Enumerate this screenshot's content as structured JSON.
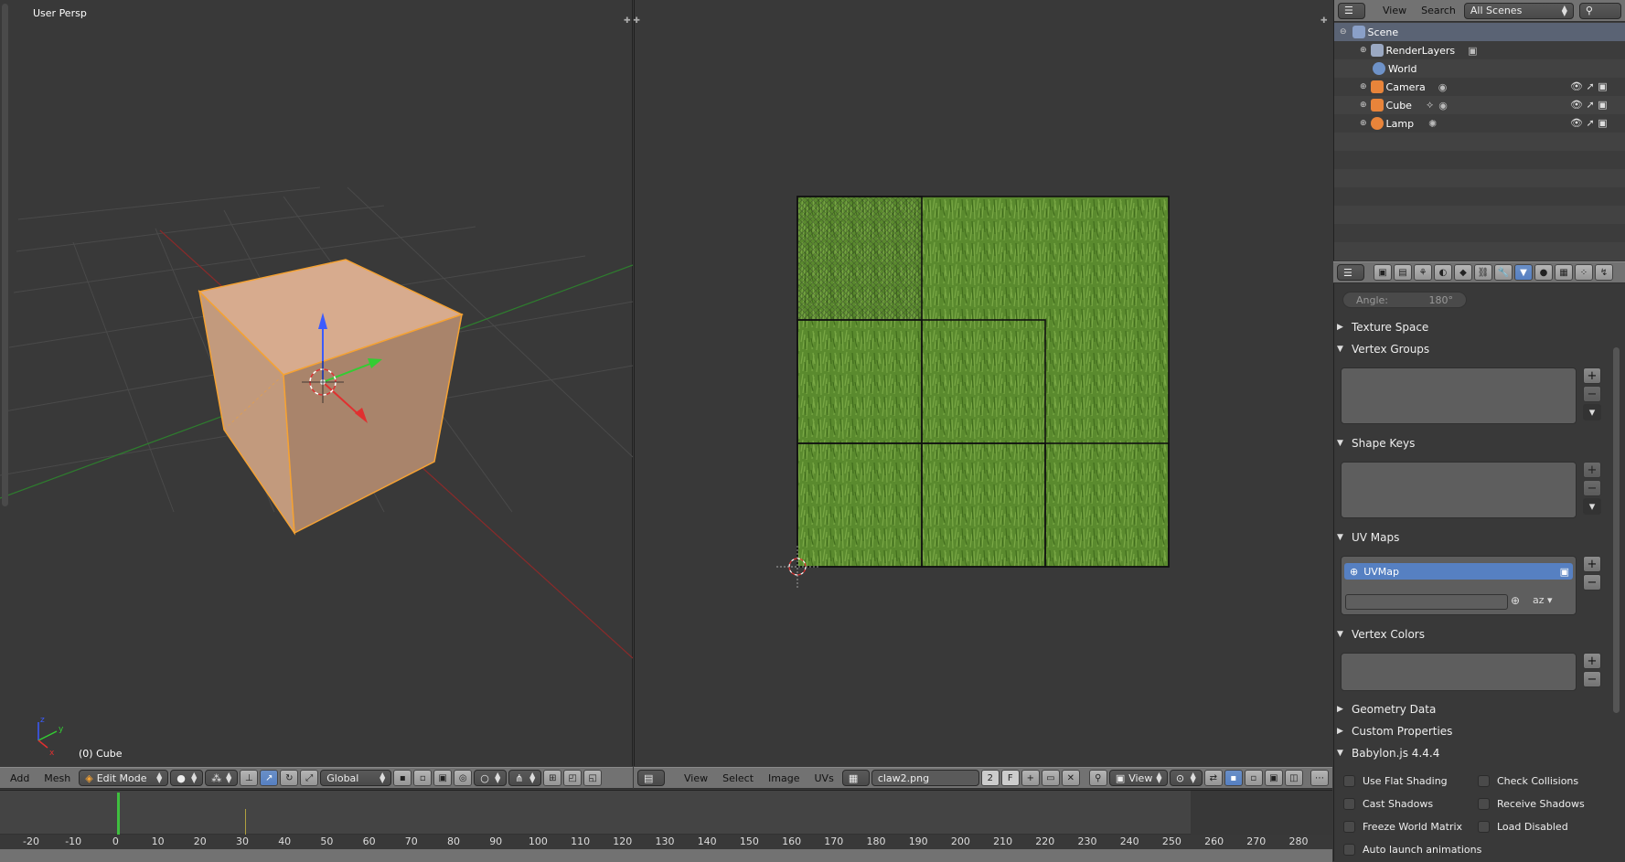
{
  "viewport3d": {
    "view_label": "User Persp",
    "object_label": "(0) Cube",
    "header": {
      "add": "Add",
      "mesh": "Mesh",
      "mode": "Edit Mode",
      "orientation": "Global"
    }
  },
  "image_editor": {
    "header": {
      "view": "View",
      "select": "Select",
      "image": "Image",
      "uvs": "UVs",
      "image_name": "claw2.png",
      "users": "2",
      "fake": "F",
      "view_dropdown": "View"
    }
  },
  "outliner": {
    "view_menu": "View",
    "search_menu": "Search",
    "display_mode": "All Scenes",
    "items": [
      {
        "label": "Scene",
        "icon": "scene-icon"
      },
      {
        "label": "RenderLayers",
        "icon": "render-layers-icon"
      },
      {
        "label": "World",
        "icon": "world-icon"
      },
      {
        "label": "Camera",
        "icon": "camera-icon"
      },
      {
        "label": "Cube",
        "icon": "mesh-icon"
      },
      {
        "label": "Lamp",
        "icon": "lamp-icon"
      }
    ]
  },
  "properties": {
    "angle_label": "Angle:",
    "angle_value": "180°",
    "panels": {
      "texture_space": "Texture Space",
      "vertex_groups": "Vertex Groups",
      "shape_keys": "Shape Keys",
      "uv_maps": "UV Maps",
      "vertex_colors": "Vertex Colors",
      "geometry_data": "Geometry Data",
      "custom_properties": "Custom Properties",
      "babylon": "Babylon.js 4.4.4"
    },
    "uv_map_name": "UVMap",
    "babylon_options": {
      "use_flat_shading": "Use Flat Shading",
      "check_collisions": "Check Collisions",
      "cast_shadows": "Cast Shadows",
      "receive_shadows": "Receive Shadows",
      "freeze_world_matrix": "Freeze World Matrix",
      "load_disabled": "Load Disabled",
      "auto_launch_animations": "Auto launch animations"
    }
  },
  "timeline": {
    "ticks": [
      "-20",
      "-10",
      "0",
      "10",
      "20",
      "30",
      "40",
      "50",
      "60",
      "70",
      "80",
      "90",
      "100",
      "110",
      "120",
      "130",
      "140",
      "150",
      "160",
      "170",
      "180",
      "190",
      "200",
      "210",
      "220",
      "230",
      "240",
      "250",
      "260",
      "270",
      "280"
    ],
    "current_frame_pos": 1
  },
  "colors": {
    "selection_orange": "#f5a233",
    "active_blue": "#5680c2",
    "grass_green": "#5a8a2e"
  }
}
